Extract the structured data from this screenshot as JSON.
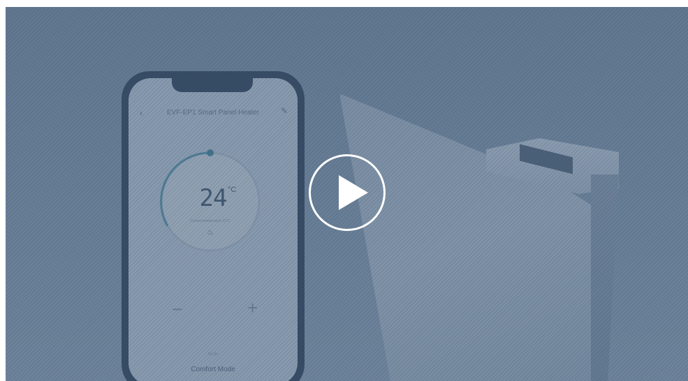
{
  "video": {
    "play_label": "Play video"
  },
  "phone_app": {
    "title": "EVF-EP1 Smart Panel Heater",
    "temperature": "24",
    "unit": "°C",
    "subtext": "Current temperature 22°C",
    "minus": "−",
    "plus": "+",
    "mode_sub": "Mode",
    "mode": "Comfort Mode",
    "dial_accent": "#5e97ad"
  },
  "colors": {
    "overlay": "#28405e",
    "play_icon": "#ffffff"
  }
}
